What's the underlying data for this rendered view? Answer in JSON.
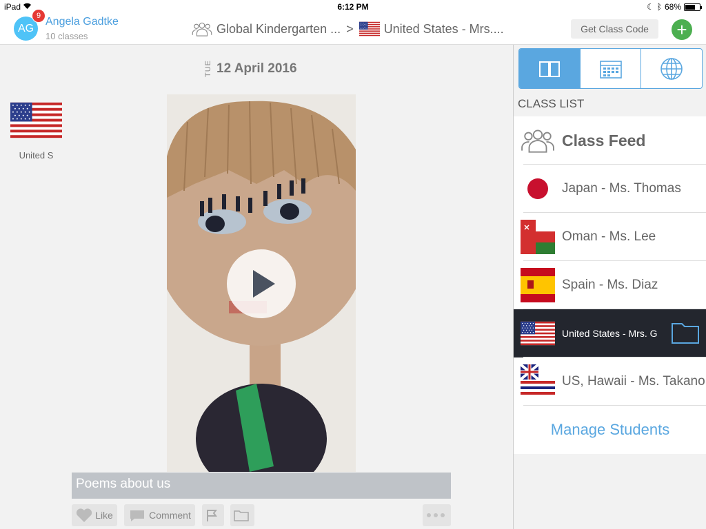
{
  "status_bar": {
    "device": "iPad",
    "time": "6:12 PM",
    "battery": "68%",
    "battery_level": 0.68
  },
  "header": {
    "avatar_initials": "AG",
    "notification_count": "9",
    "user_name": "Angela Gadtke",
    "user_subtitle": "10 classes",
    "breadcrumb_parent": "Global Kindergarten ...",
    "breadcrumb_separator": ">",
    "breadcrumb_current": "United States - Mrs....",
    "get_code_label": "Get Class Code",
    "add_label": "+"
  },
  "feed": {
    "day_of_week": "TUE",
    "date": "12 April 2016",
    "author_label": "United S",
    "caption": "Poems about us",
    "actions": {
      "like": "Like",
      "comment": "Comment"
    }
  },
  "sidebar": {
    "tabs": [
      "book-icon",
      "calendar-icon",
      "globe-icon"
    ],
    "active_tab": 0,
    "list_title": "CLASS LIST",
    "items": [
      {
        "label": "Class Feed",
        "icon": "people-icon"
      },
      {
        "label": "Japan - Ms. Thomas",
        "icon": "japan-flag-icon"
      },
      {
        "label": "Oman - Ms. Lee",
        "icon": "oman-flag-icon"
      },
      {
        "label": "Spain - Ms. Diaz",
        "icon": "spain-flag-icon"
      },
      {
        "label": "United States - Mrs. G",
        "icon": "us-flag-icon",
        "selected": true
      },
      {
        "label": "US, Hawaii - Ms. Takano",
        "icon": "hawaii-flag-icon"
      }
    ],
    "manage_label": "Manage Students"
  },
  "colors": {
    "accent": "#5aa7e0",
    "selected_row": "#23262e",
    "add": "#4caf50",
    "badge": "#e53935"
  }
}
